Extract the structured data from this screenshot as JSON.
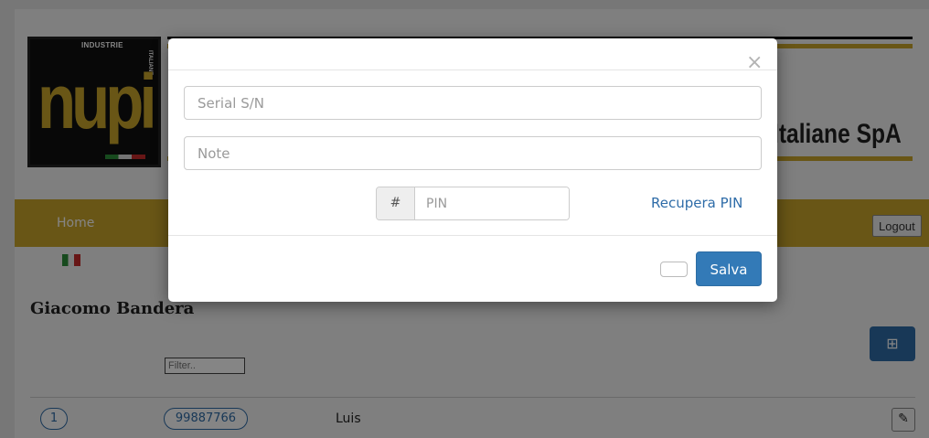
{
  "header": {
    "logo_tag_industrie": "INDUSTRIE",
    "logo_tag_italiane": "ITALIANE",
    "logo_word": "nupi",
    "company_name": "Italiane SpA"
  },
  "nav": {
    "home_label": "Home",
    "logout_label": "Logout"
  },
  "main": {
    "user_name": "Giacomo Bandera",
    "filter_placeholder": "Filter..",
    "add_icon": "plus-square-icon",
    "rows": [
      {
        "num": "1",
        "serial": "99887766",
        "name": "Luis"
      }
    ]
  },
  "modal": {
    "close_glyph": "×",
    "serial_placeholder": "Serial S/N",
    "note_placeholder": "Note",
    "pin_addon": "#",
    "pin_placeholder": "PIN",
    "recover_pin_label": "Recupera PIN",
    "save_label": "Salva"
  },
  "colors": {
    "brand_yellow": "#c9a52b",
    "primary_blue": "#337ab7"
  }
}
